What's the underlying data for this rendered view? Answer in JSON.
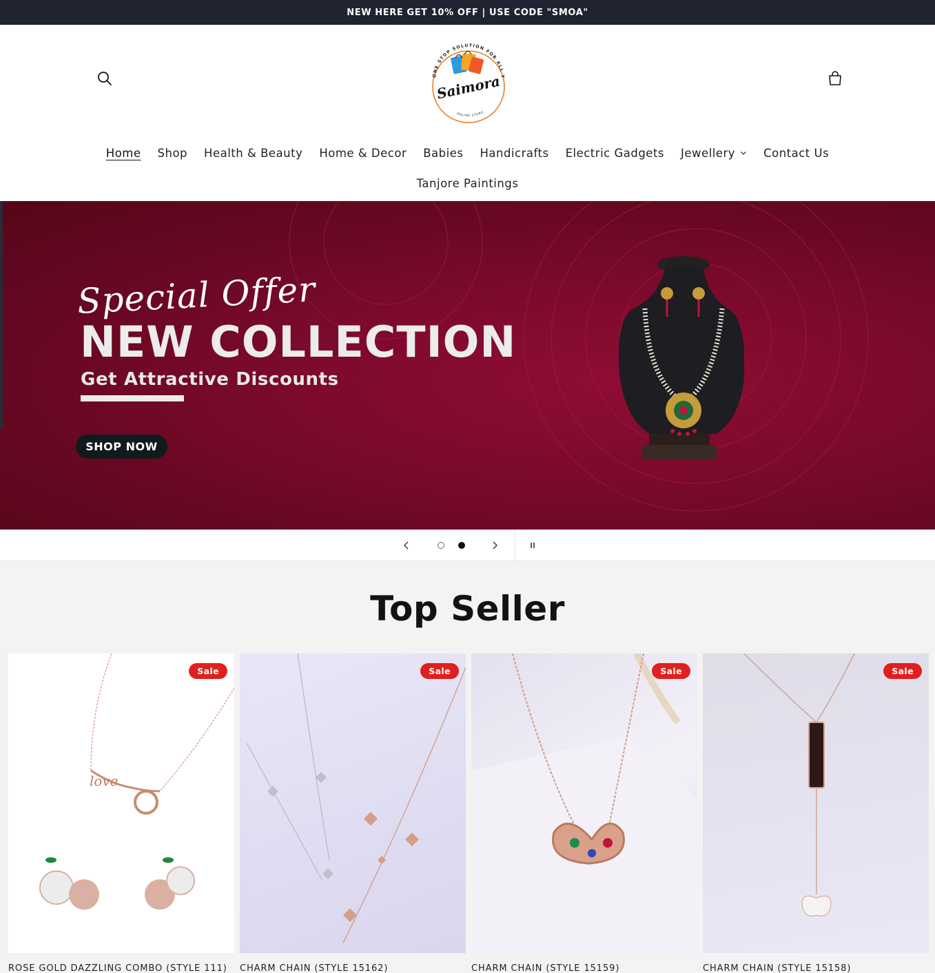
{
  "announcement": "NEW HERE GET 10% OFF | USE CODE \"SMOA\"",
  "logo": {
    "brand": "Saimora",
    "tagline": "ONE STOP SOLUTION FOR ALL YOUR NEEDS",
    "subline": "ONLINE STORE"
  },
  "header_icons": [
    "search-icon",
    "cart-icon"
  ],
  "nav": {
    "row1": [
      {
        "label": "Home",
        "active": true
      },
      {
        "label": "Shop"
      },
      {
        "label": "Health & Beauty"
      },
      {
        "label": "Home & Decor"
      },
      {
        "label": "Babies"
      },
      {
        "label": "Handicrafts"
      },
      {
        "label": "Electric Gadgets"
      },
      {
        "label": "Jewellery",
        "dropdown": true
      },
      {
        "label": "Contact Us"
      }
    ],
    "row2": [
      {
        "label": "Tanjore Paintings"
      }
    ]
  },
  "hero": {
    "script": "Special Offer",
    "title": "NEW COLLECTION",
    "subtitle": "Get Attractive Discounts",
    "cta": "SHOP NOW",
    "colors": {
      "background": "#7d0a2c",
      "cta": "#111a1c"
    }
  },
  "slider": {
    "slides": 2,
    "current": 2,
    "icons": [
      "chevron-left-icon",
      "chevron-right-icon",
      "pause-icon"
    ]
  },
  "top_seller": {
    "title": "Top Seller",
    "products": [
      {
        "title": "ROSE GOLD DAZZLING COMBO (STYLE 111)",
        "badge": "Sale"
      },
      {
        "title": "CHARM CHAIN (STYLE 15162)",
        "badge": "Sale"
      },
      {
        "title": "CHARM CHAIN (STYLE 15159)",
        "badge": "Sale"
      },
      {
        "title": "CHARM CHAIN (STYLE 15158)",
        "badge": "Sale"
      }
    ]
  },
  "colors": {
    "announcement_bg": "#1f2430",
    "sale_badge": "#e0201e",
    "section_bg": "#f3f3f3"
  }
}
